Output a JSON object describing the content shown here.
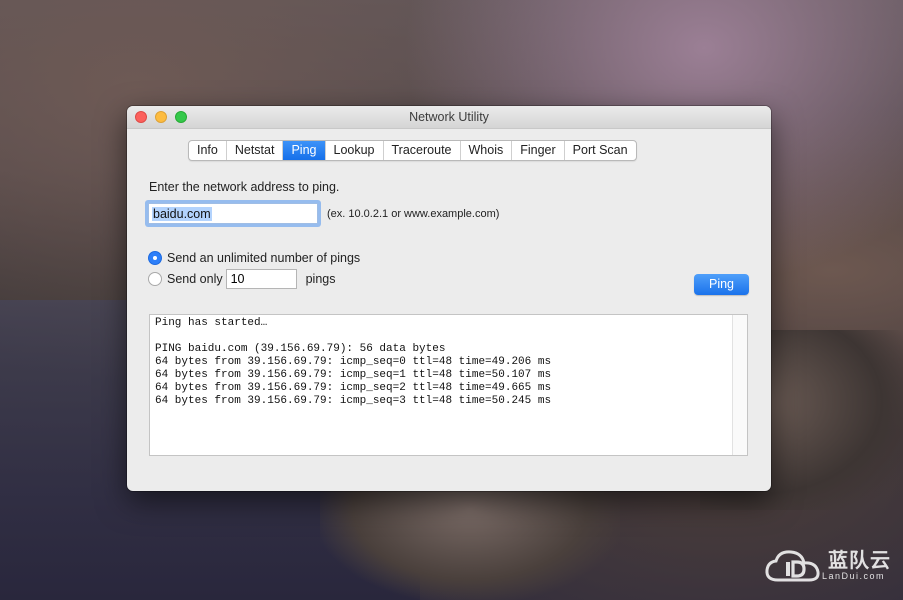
{
  "window": {
    "title": "Network Utility"
  },
  "tabs": [
    {
      "label": "Info",
      "active": false
    },
    {
      "label": "Netstat",
      "active": false
    },
    {
      "label": "Ping",
      "active": true
    },
    {
      "label": "Lookup",
      "active": false
    },
    {
      "label": "Traceroute",
      "active": false
    },
    {
      "label": "Whois",
      "active": false
    },
    {
      "label": "Finger",
      "active": false
    },
    {
      "label": "Port Scan",
      "active": false
    }
  ],
  "ping": {
    "prompt": "Enter the network address to ping.",
    "address": "baidu.com",
    "hint": "(ex. 10.0.2.1 or www.example.com)",
    "option_unlimited": "Send an unlimited number of pings",
    "option_limited": "Send only",
    "count": "10",
    "count_suffix": "pings",
    "selected_option": "unlimited",
    "button_label": "Ping"
  },
  "output": {
    "lines": [
      "Ping has started…",
      "",
      "PING baidu.com (39.156.69.79): 56 data bytes",
      "64 bytes from 39.156.69.79: icmp_seq=0 ttl=48 time=49.206 ms",
      "64 bytes from 39.156.69.79: icmp_seq=1 ttl=48 time=50.107 ms",
      "64 bytes from 39.156.69.79: icmp_seq=2 ttl=48 time=49.665 ms",
      "64 bytes from 39.156.69.79: icmp_seq=3 ttl=48 time=50.245 ms"
    ]
  },
  "watermark": {
    "name": "蓝队云",
    "sub": "LanDui.com"
  },
  "colors": {
    "accent": "#1670ea",
    "close": "#fc605c",
    "minimize": "#fdbc40",
    "maximize": "#34c84a"
  }
}
